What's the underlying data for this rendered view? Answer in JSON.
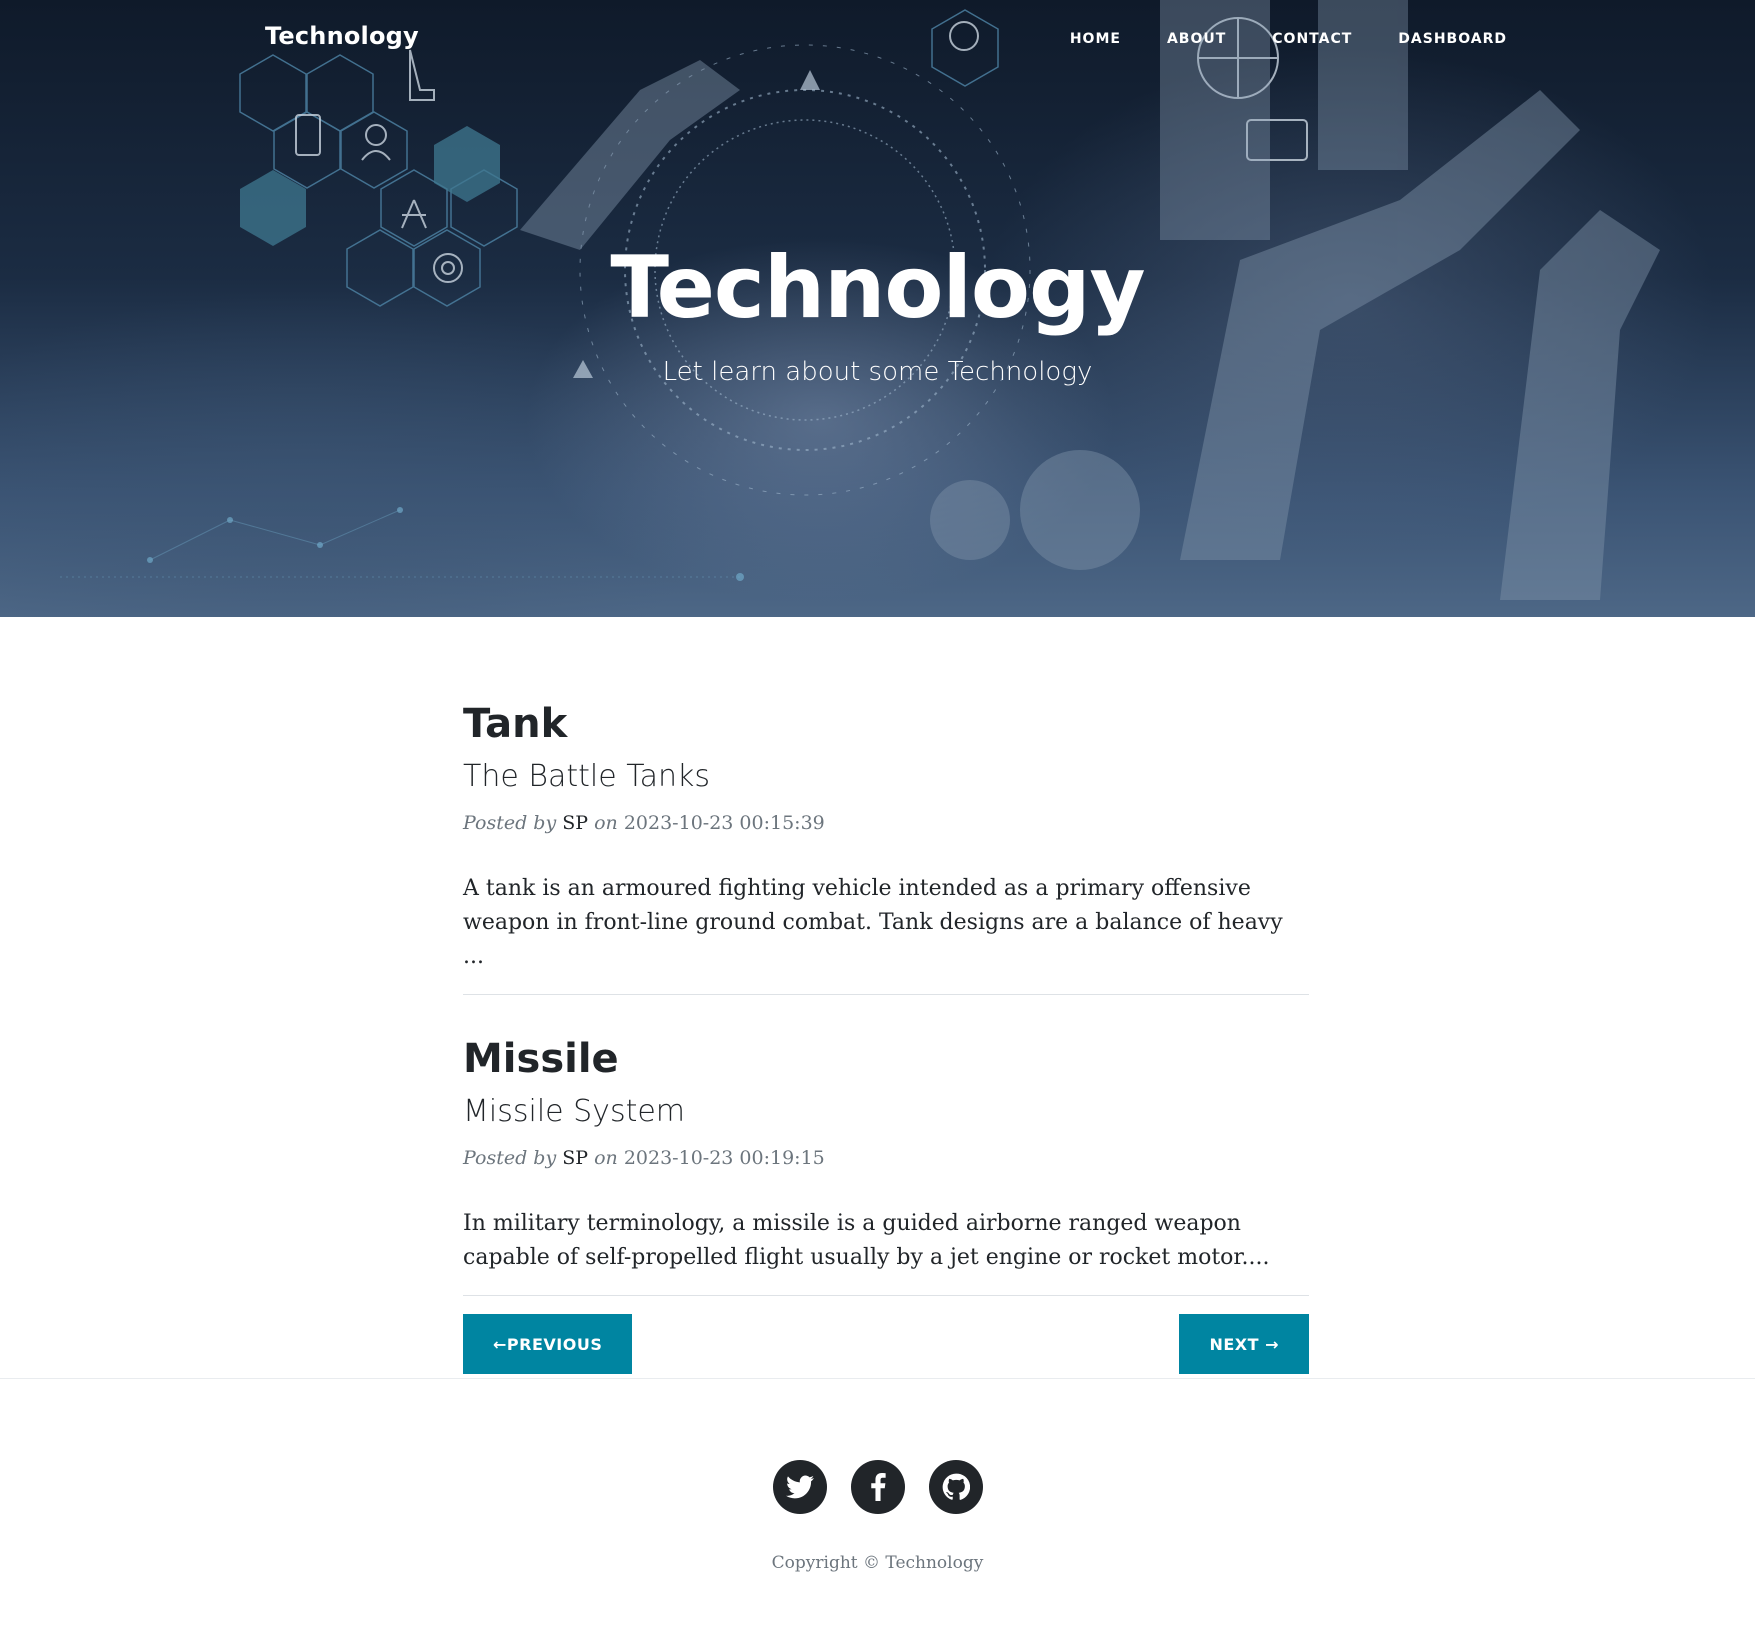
{
  "colors": {
    "accent": "#0085a1",
    "dark": "#212529",
    "muted": "#6c757d"
  },
  "header": {
    "brand": "Technology",
    "nav": [
      {
        "label": "HOME"
      },
      {
        "label": "ABOUT"
      },
      {
        "label": "CONTACT"
      },
      {
        "label": "DASHBOARD"
      }
    ],
    "title": "Technology",
    "subtitle": "Let learn about some Technology"
  },
  "posts": [
    {
      "title": "Tank",
      "subtitle": "The Battle Tanks",
      "posted_by": "Posted by",
      "author": "SP",
      "on": "on",
      "date": "2023-10-23 00:15:39",
      "excerpt": "A tank is an armoured fighting vehicle intended as a primary offensive weapon in front-line ground combat. Tank designs are a balance of heavy ..."
    },
    {
      "title": "Missile",
      "subtitle": "Missile System",
      "posted_by": "Posted by",
      "author": "SP",
      "on": "on",
      "date": "2023-10-23 00:19:15",
      "excerpt": "In military terminology, a missile is a guided airborne ranged weapon capable of self-propelled flight usually by a jet engine or rocket motor...."
    }
  ],
  "pager": {
    "previous": "←PREVIOUS",
    "next": "NEXT →"
  },
  "footer": {
    "social": [
      "twitter-icon",
      "facebook-icon",
      "github-icon"
    ],
    "copyright": "Copyright © Technology"
  }
}
